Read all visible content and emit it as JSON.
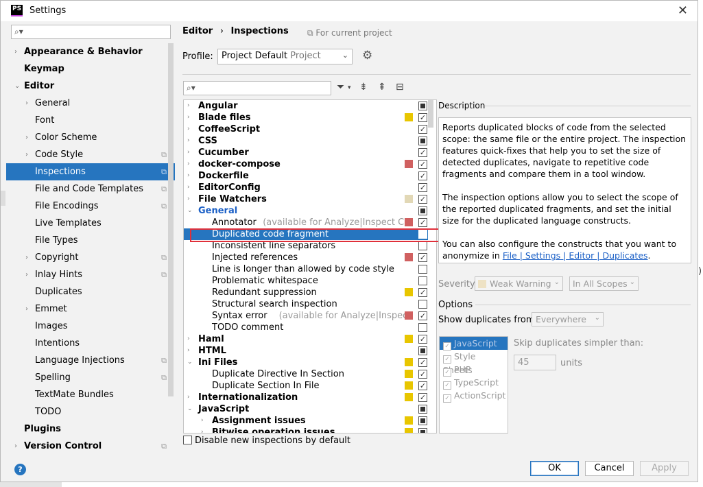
{
  "window": {
    "title": "Settings",
    "logo": "PS"
  },
  "sidebar": {
    "items": [
      {
        "label": "Appearance & Behavior",
        "bold": true,
        "arrow": "›",
        "indent": 0
      },
      {
        "label": "Keymap",
        "bold": true,
        "arrow": "",
        "indent": 0
      },
      {
        "label": "Editor",
        "bold": true,
        "arrow": "⌄",
        "indent": 0
      },
      {
        "label": "General",
        "arrow": "›",
        "indent": 1
      },
      {
        "label": "Font",
        "arrow": "",
        "indent": 1
      },
      {
        "label": "Color Scheme",
        "arrow": "›",
        "indent": 1
      },
      {
        "label": "Code Style",
        "arrow": "›",
        "indent": 1,
        "copy": true
      },
      {
        "label": "Inspections",
        "arrow": "",
        "indent": 1,
        "copy": true,
        "selected": true
      },
      {
        "label": "File and Code Templates",
        "arrow": "",
        "indent": 1,
        "copy": true
      },
      {
        "label": "File Encodings",
        "arrow": "",
        "indent": 1,
        "copy": true
      },
      {
        "label": "Live Templates",
        "arrow": "",
        "indent": 1
      },
      {
        "label": "File Types",
        "arrow": "",
        "indent": 1
      },
      {
        "label": "Copyright",
        "arrow": "›",
        "indent": 1,
        "copy": true
      },
      {
        "label": "Inlay Hints",
        "arrow": "›",
        "indent": 1,
        "copy": true
      },
      {
        "label": "Duplicates",
        "arrow": "",
        "indent": 1
      },
      {
        "label": "Emmet",
        "arrow": "›",
        "indent": 1
      },
      {
        "label": "Images",
        "arrow": "",
        "indent": 1
      },
      {
        "label": "Intentions",
        "arrow": "",
        "indent": 1
      },
      {
        "label": "Language Injections",
        "arrow": "",
        "indent": 1,
        "copy": true
      },
      {
        "label": "Spelling",
        "arrow": "",
        "indent": 1,
        "copy": true
      },
      {
        "label": "TextMate Bundles",
        "arrow": "",
        "indent": 1
      },
      {
        "label": "TODO",
        "arrow": "",
        "indent": 1
      },
      {
        "label": "Plugins",
        "bold": true,
        "arrow": "",
        "indent": 0
      },
      {
        "label": "Version Control",
        "bold": true,
        "arrow": "›",
        "indent": 0,
        "copy": true
      }
    ]
  },
  "breadcrumb": {
    "first": "Editor",
    "sep": "›",
    "second": "Inspections"
  },
  "for_project": "For current project",
  "profile": {
    "label": "Profile:",
    "value": "Project Default",
    "scope": "Project"
  },
  "inspections": [
    {
      "label": "Angular",
      "bold": true,
      "arrow": "›",
      "check": "mixed"
    },
    {
      "label": "Blade files",
      "bold": true,
      "arrow": "›",
      "sev": "#e8c600",
      "check": "checked"
    },
    {
      "label": "CoffeeScript",
      "bold": true,
      "arrow": "›",
      "check": "checked"
    },
    {
      "label": "CSS",
      "bold": true,
      "arrow": "›",
      "check": "mixed"
    },
    {
      "label": "Cucumber",
      "bold": true,
      "arrow": "›",
      "check": "checked"
    },
    {
      "label": "docker-compose",
      "bold": true,
      "arrow": "›",
      "sev": "#d06060",
      "check": "checked"
    },
    {
      "label": "Dockerfile",
      "bold": true,
      "arrow": "›",
      "check": "checked"
    },
    {
      "label": "EditorConfig",
      "bold": true,
      "arrow": "›",
      "check": "checked"
    },
    {
      "label": "File Watchers",
      "bold": true,
      "arrow": "›",
      "sev": "#e2d8b6",
      "check": "checked"
    },
    {
      "label": "General",
      "bold": true,
      "arrow": "⌄",
      "check": "mixed",
      "blue": true
    },
    {
      "label": "Annotator",
      "note": "(available for Analyze|Inspect Code)",
      "child": true,
      "sev": "#d06060",
      "check": "checked"
    },
    {
      "label": "Duplicated code fragment",
      "child": true,
      "check": "unchecked",
      "selected": true
    },
    {
      "label": "Inconsistent line separators",
      "child": true,
      "check": "unchecked"
    },
    {
      "label": "Injected references",
      "child": true,
      "sev": "#d06060",
      "check": "checked"
    },
    {
      "label": "Line is longer than allowed by code style",
      "child": true,
      "check": "unchecked"
    },
    {
      "label": "Problematic whitespace",
      "child": true,
      "check": "unchecked"
    },
    {
      "label": "Redundant suppression",
      "child": true,
      "sev": "#e8c600",
      "check": "checked"
    },
    {
      "label": "Structural search inspection",
      "child": true,
      "check": "unchecked"
    },
    {
      "label": "Syntax error",
      "note": "(available for Analyze|Inspect Code)",
      "child": true,
      "sev": "#d06060",
      "check": "checked"
    },
    {
      "label": "TODO comment",
      "child": true,
      "check": "unchecked"
    },
    {
      "label": "Haml",
      "bold": true,
      "arrow": "›",
      "sev": "#e8c600",
      "check": "checked"
    },
    {
      "label": "HTML",
      "bold": true,
      "arrow": "›",
      "check": "mixed"
    },
    {
      "label": "Ini Files",
      "bold": true,
      "arrow": "⌄",
      "sev": "#e8c600",
      "check": "checked"
    },
    {
      "label": "Duplicate Directive In Section",
      "child": true,
      "sev": "#e8c600",
      "check": "checked"
    },
    {
      "label": "Duplicate Section In File",
      "child": true,
      "sev": "#e8c600",
      "check": "checked"
    },
    {
      "label": "Internationalization",
      "bold": true,
      "arrow": "›",
      "sev": "#e8c600",
      "check": "checked"
    },
    {
      "label": "JavaScript",
      "bold": true,
      "arrow": "⌄",
      "check": "mixed"
    },
    {
      "label": "Assignment issues",
      "bold": true,
      "arrow": "›",
      "child": true,
      "sev": "#e8c600",
      "check": "mixed"
    },
    {
      "label": "Bitwise operation issues",
      "bold": true,
      "arrow": "›",
      "child": true,
      "sev": "#e8c600",
      "check": "mixed"
    }
  ],
  "description": {
    "label": "Description",
    "p1": "Reports duplicated blocks of code from the selected scope: the same file or the entire project. The inspection features quick-fixes that help you to set the size of detected duplicates, navigate to repetitive code fragments and compare them in a tool window.",
    "p2": "The inspection options allow you to select the scope of the reported duplicated fragments, and set the initial size for the duplicated language constructs.",
    "p3": "You can also configure the constructs that you want to anonymize in",
    "link": "File | Settings | Editor | Duplicates",
    "p3_end": "."
  },
  "severity": {
    "label": "Severity:",
    "value": "Weak Warning",
    "scope": "In All Scopes"
  },
  "options": {
    "label": "Options",
    "show_label": "Show duplicates from:",
    "show_value": "Everywhere",
    "languages": [
      "JavaScript",
      "Style Sheets",
      "PHP",
      "TypeScript",
      "ActionScript"
    ],
    "skip_label": "Skip duplicates simpler than:",
    "skip_value": "45",
    "units": "units"
  },
  "disable_new": "Disable new inspections by default",
  "buttons": {
    "ok": "OK",
    "cancel": "Cancel",
    "apply": "Apply",
    "help": "?"
  },
  "stray": ")"
}
